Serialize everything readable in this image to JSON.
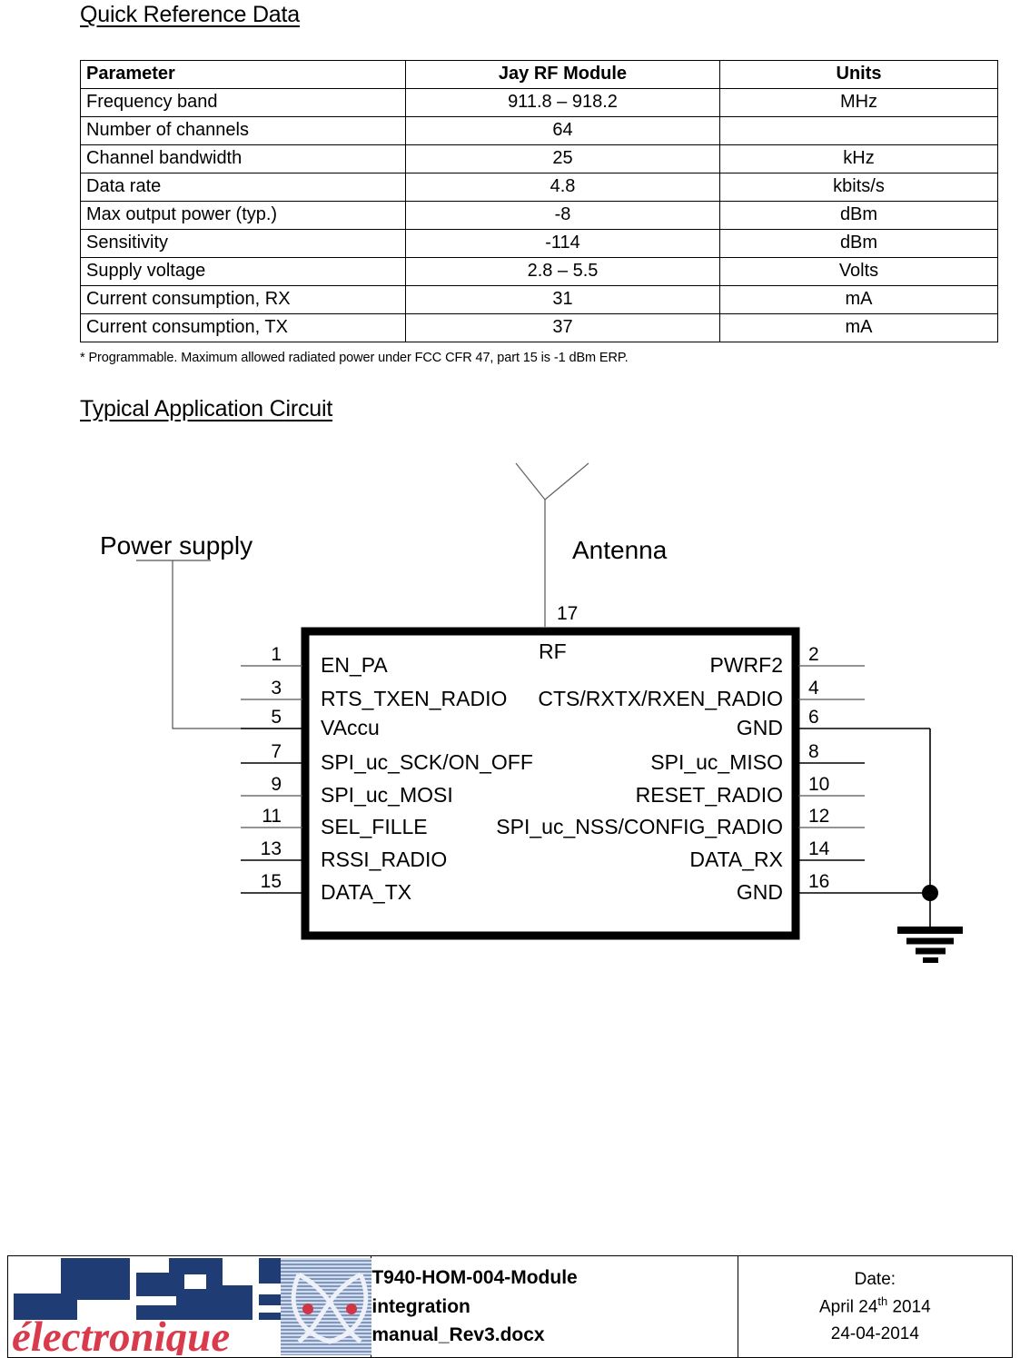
{
  "document": {
    "sections": [
      {
        "id": "quick_reference",
        "heading": "Quick Reference Data"
      },
      {
        "id": "typical_circuit",
        "heading": "Typical Application Circuit"
      }
    ]
  },
  "quick_reference_table": {
    "columns": [
      "Parameter",
      "Jay RF Module",
      "Units"
    ],
    "rows": [
      {
        "parameter": "Frequency band",
        "value": "911.8 – 918.2",
        "units": "MHz"
      },
      {
        "parameter": "Number of channels",
        "value": "64",
        "units": ""
      },
      {
        "parameter": "Channel bandwidth",
        "value": "25",
        "units": "kHz"
      },
      {
        "parameter": "Data rate",
        "value": "4.8",
        "units": "kbits/s"
      },
      {
        "parameter": "Max output power (typ.)",
        "value": "-8",
        "units": "dBm"
      },
      {
        "parameter": "Sensitivity",
        "value": "-114",
        "units": "dBm"
      },
      {
        "parameter": "Supply voltage",
        "value": "2.8 – 5.5",
        "units": "Volts"
      },
      {
        "parameter": "Current consumption, RX",
        "value": "31",
        "units": "mA"
      },
      {
        "parameter": "Current consumption, TX",
        "value": "37",
        "units": "mA"
      }
    ],
    "footnote": "* Programmable. Maximum allowed radiated power under FCC CFR 47, part 15 is -1 dBm ERP."
  },
  "circuit": {
    "annotations": {
      "power_supply": "Power supply",
      "antenna": "Antenna",
      "rf": "RF",
      "antenna_pin": "17"
    },
    "left_pins": [
      {
        "number": "1",
        "label": "EN_PA"
      },
      {
        "number": "3",
        "label": "RTS_TXEN_RADIO"
      },
      {
        "number": "5",
        "label": "VAccu"
      },
      {
        "number": "7",
        "label": "SPI_uc_SCK/ON_OFF"
      },
      {
        "number": "9",
        "label": "SPI_uc_MOSI"
      },
      {
        "number": "11",
        "label": "SEL_FILLE"
      },
      {
        "number": "13",
        "label": "RSSI_RADIO"
      },
      {
        "number": "15",
        "label": "DATA_TX"
      }
    ],
    "right_pins": [
      {
        "number": "2",
        "label": "PWRF2"
      },
      {
        "number": "4",
        "label": "CTS/RXTX/RXEN_RADIO"
      },
      {
        "number": "6",
        "label": "GND"
      },
      {
        "number": "8",
        "label": "SPI_uc_MISO"
      },
      {
        "number": "10",
        "label": "RESET_RADIO"
      },
      {
        "number": "12",
        "label": "SPI_uc_NSS/CONFIG_RADIO"
      },
      {
        "number": "14",
        "label": "DATA_RX"
      },
      {
        "number": "16",
        "label": "GND"
      }
    ]
  },
  "footer": {
    "logo": {
      "brand": "Jay",
      "subtitle": "électronique",
      "brand_color": "#1F3C74",
      "subtitle_color": "#D93B4C"
    },
    "document_name_lines": [
      "T940-HOM-004-Module",
      "integration",
      "manual_Rev3.docx"
    ],
    "date_label": "Date:",
    "date_long_prefix": "April 24",
    "date_long_suffix": " 2014",
    "date_ordinal": "th",
    "date_numeric": "24-04-2014"
  }
}
